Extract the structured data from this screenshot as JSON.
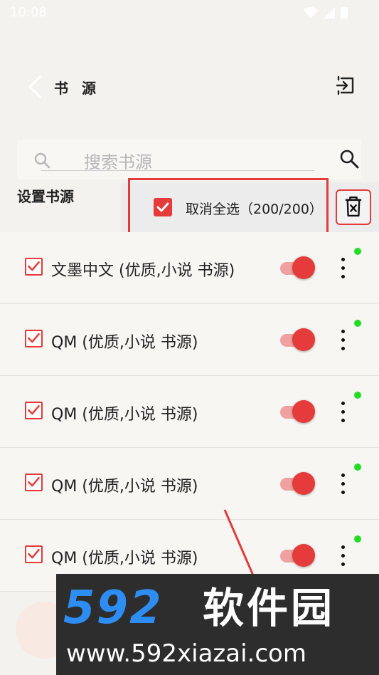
{
  "status_bar": {
    "time": "10:08"
  },
  "app_bar": {
    "title": "书 源"
  },
  "search": {
    "placeholder": "搜索书源"
  },
  "section": {
    "title": "设置书源"
  },
  "selection": {
    "label": "取消全选（200/200）"
  },
  "sources": [
    {
      "name": "文墨中文 (优质,小说 书源)",
      "checked": true,
      "enabled": true
    },
    {
      "name": "QM (优质,小说 书源)",
      "checked": true,
      "enabled": true
    },
    {
      "name": "QM (优质,小说 书源)",
      "checked": true,
      "enabled": true
    },
    {
      "name": "QM (优质,小说 书源)",
      "checked": true,
      "enabled": true
    },
    {
      "name": "QM (优质,小说 书源)",
      "checked": true,
      "enabled": true
    }
  ],
  "watermark": {
    "number": "592",
    "brand": "软件园",
    "url": "www.592xiazai.com"
  },
  "colors": {
    "accent": "#e53b3b",
    "status_online": "#22dd22",
    "watermark_blue": "#2e8df2"
  },
  "icons": {
    "back": "chevron-left-icon",
    "import": "import-icon",
    "search": "search-icon",
    "delete": "trash-icon",
    "more": "more-vertical-icon"
  }
}
